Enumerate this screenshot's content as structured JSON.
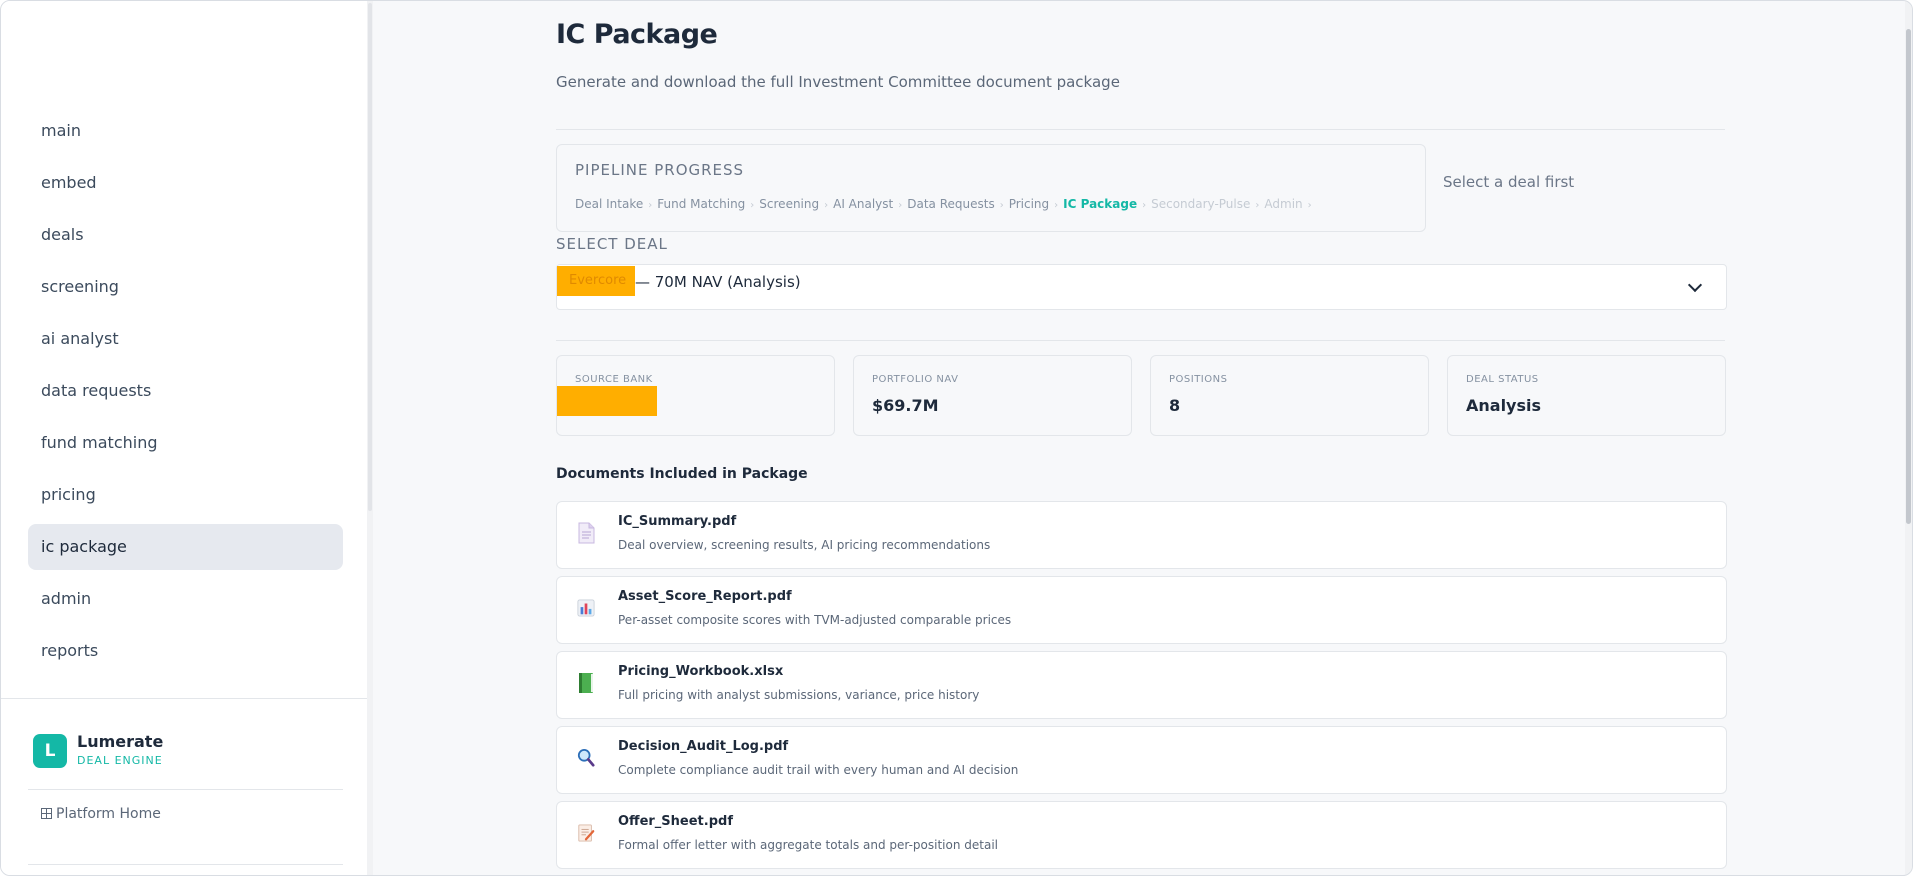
{
  "sidebar": {
    "items": [
      {
        "label": "main"
      },
      {
        "label": "embed"
      },
      {
        "label": "deals"
      },
      {
        "label": "screening"
      },
      {
        "label": "ai analyst"
      },
      {
        "label": "data requests"
      },
      {
        "label": "fund matching"
      },
      {
        "label": "pricing"
      },
      {
        "label": "ic package",
        "active": true
      },
      {
        "label": "admin"
      },
      {
        "label": "reports"
      }
    ],
    "brand": {
      "logo_letter": "L",
      "name": "Lumerate",
      "subtitle": "DEAL ENGINE"
    },
    "platform_home": "Platform Home"
  },
  "page": {
    "title": "IC Package",
    "subtitle": "Generate and download the full Investment Committee document package"
  },
  "pipeline": {
    "title": "PIPELINE PROGRESS",
    "steps": [
      {
        "label": "Deal Intake",
        "state": "done"
      },
      {
        "label": "Fund Matching",
        "state": "done"
      },
      {
        "label": "Screening",
        "state": "done"
      },
      {
        "label": "AI Analyst",
        "state": "done"
      },
      {
        "label": "Data Requests",
        "state": "done"
      },
      {
        "label": "Pricing",
        "state": "done"
      },
      {
        "label": "IC Package",
        "state": "active"
      },
      {
        "label": "Secondary-Pulse",
        "state": "pending"
      },
      {
        "label": "Admin",
        "state": "pending"
      }
    ],
    "separator": "›",
    "hint": "Select a deal first"
  },
  "select_deal": {
    "label": "SELECT DEAL",
    "redacted_text": "Evercore",
    "value": "— 70M NAV (Analysis)"
  },
  "stats": [
    {
      "label": "SOURCE BANK",
      "value": "",
      "redacted": true
    },
    {
      "label": "PORTFOLIO NAV",
      "value": "$69.7M"
    },
    {
      "label": "POSITIONS",
      "value": "8"
    },
    {
      "label": "DEAL STATUS",
      "value": "Analysis"
    }
  ],
  "documents": {
    "title": "Documents Included in Package",
    "items": [
      {
        "name": "IC_Summary.pdf",
        "desc": "Deal overview, screening results, AI pricing recommendations",
        "icon": "document-icon"
      },
      {
        "name": "Asset_Score_Report.pdf",
        "desc": "Per-asset composite scores with TVM-adjusted comparable prices",
        "icon": "bar-chart-icon"
      },
      {
        "name": "Pricing_Workbook.xlsx",
        "desc": "Full pricing with analyst submissions, variance, price history",
        "icon": "green-book-icon"
      },
      {
        "name": "Decision_Audit_Log.pdf",
        "desc": "Complete compliance audit trail with every human and AI decision",
        "icon": "magnifier-icon"
      },
      {
        "name": "Offer_Sheet.pdf",
        "desc": "Formal offer letter with aggregate totals and per-position detail",
        "icon": "memo-icon"
      }
    ]
  },
  "colors": {
    "accent": "#14b8a6",
    "redaction": "#ffae00",
    "text": "#1e2a3b",
    "muted": "#5b6778"
  }
}
